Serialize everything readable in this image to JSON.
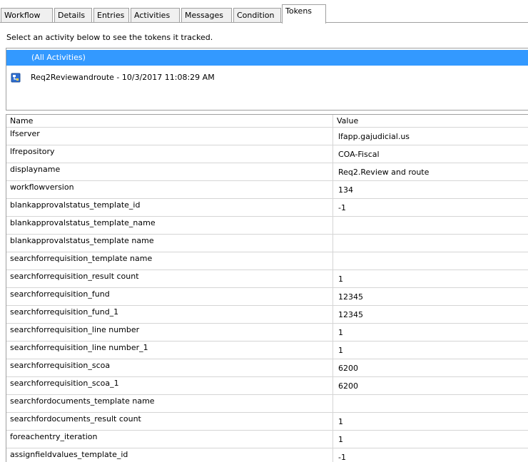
{
  "tabs": [
    {
      "label": "Workflow",
      "active": false
    },
    {
      "label": "Details",
      "active": false
    },
    {
      "label": "Entries",
      "active": false
    },
    {
      "label": "Activities",
      "active": false
    },
    {
      "label": "Messages",
      "active": false
    },
    {
      "label": "Condition",
      "active": false
    },
    {
      "label": "Tokens",
      "active": true
    }
  ],
  "instruction": "Select an activity below to see the tokens it tracked.",
  "activities": {
    "selected_label": "(All Activities)",
    "items": [
      {
        "label": "Req2Reviewandroute - 10/3/2017 11:08:29 AM",
        "icon": "workflow-activity-icon"
      }
    ]
  },
  "grid": {
    "columns": {
      "name": "Name",
      "value": "Value"
    },
    "rows": [
      {
        "name": "lfserver",
        "value": "lfapp.gajudicial.us"
      },
      {
        "name": "lfrepository",
        "value": "COA-Fiscal"
      },
      {
        "name": "displayname",
        "value": "Req2.Review and route"
      },
      {
        "name": "workflowversion",
        "value": "134"
      },
      {
        "name": "blankapprovalstatus_template_id",
        "value": "-1"
      },
      {
        "name": "blankapprovalstatus_template_name",
        "value": ""
      },
      {
        "name": "blankapprovalstatus_template name",
        "value": ""
      },
      {
        "name": "searchforrequisition_template name",
        "value": ""
      },
      {
        "name": "searchforrequisition_result count",
        "value": "1"
      },
      {
        "name": "searchforrequisition_fund",
        "value": "12345"
      },
      {
        "name": "searchforrequisition_fund_1",
        "value": "12345"
      },
      {
        "name": "searchforrequisition_line number",
        "value": "1"
      },
      {
        "name": "searchforrequisition_line number_1",
        "value": "1"
      },
      {
        "name": "searchforrequisition_scoa",
        "value": "6200"
      },
      {
        "name": "searchforrequisition_scoa_1",
        "value": "6200"
      },
      {
        "name": "searchfordocuments_template name",
        "value": ""
      },
      {
        "name": "searchfordocuments_result count",
        "value": "1"
      },
      {
        "name": "foreachentry_iteration",
        "value": "1"
      },
      {
        "name": "assignfieldvalues_template_id",
        "value": "-1"
      }
    ]
  },
  "colors": {
    "selection": "#3399ff",
    "tab_background": "#f0f0f0",
    "border": "#a0a0a0",
    "grid_line": "#d5d5d5"
  }
}
